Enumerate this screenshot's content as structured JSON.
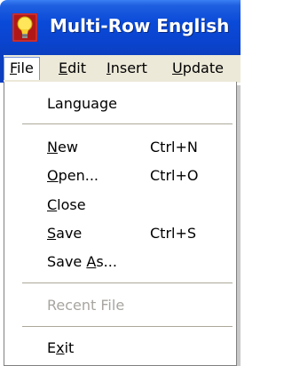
{
  "window": {
    "title": "Multi-Row English",
    "icon": "lightbulb-icon"
  },
  "menubar": {
    "items": [
      {
        "label": "File",
        "mnemonic_index": 0
      },
      {
        "label": "Edit",
        "mnemonic_index": 0
      },
      {
        "label": "Insert",
        "mnemonic_index": 0
      },
      {
        "label": "Update",
        "mnemonic_index": 0
      }
    ]
  },
  "file_menu": {
    "items": [
      {
        "label": "Language",
        "shortcut": "",
        "enabled": true
      },
      {
        "label": "New",
        "shortcut": "Ctrl+N",
        "enabled": true
      },
      {
        "label": "Open...",
        "shortcut": "Ctrl+O",
        "enabled": true
      },
      {
        "label": "Close",
        "shortcut": "",
        "enabled": true
      },
      {
        "label": "Save",
        "shortcut": "Ctrl+S",
        "enabled": true
      },
      {
        "label": "Save As...",
        "shortcut": "",
        "enabled": true
      },
      {
        "label": "Recent File",
        "shortcut": "",
        "enabled": false
      },
      {
        "label": "Exit",
        "shortcut": "",
        "enabled": true
      }
    ]
  },
  "colors": {
    "titlebar": "#0a4ad8",
    "menubar": "#ece9d8",
    "menu_background": "#ffffff",
    "disabled_text": "#a8a5a0"
  }
}
